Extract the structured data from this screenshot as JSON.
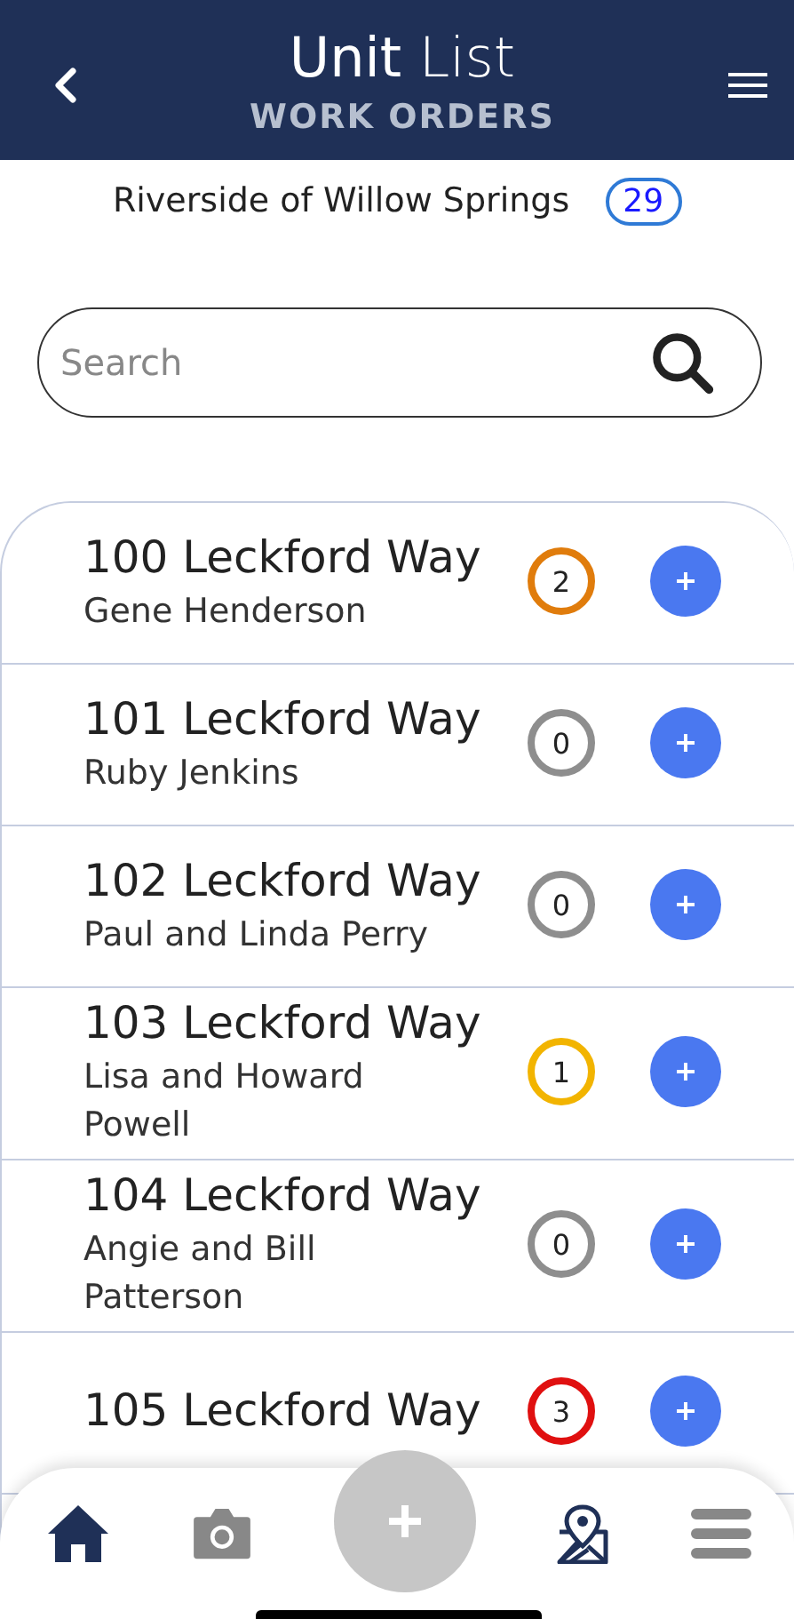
{
  "header": {
    "title": "**Unit** List",
    "subtitle": "WORK ORDERS"
  },
  "property": {
    "name": "Riverside of Willow Springs",
    "count": "29"
  },
  "search": {
    "placeholder": "Search"
  },
  "units": [
    {
      "address": "100 Leckford Way",
      "resident": "Gene Henderson",
      "count": "2",
      "color": "#e07c0c"
    },
    {
      "address": "101 Leckford Way",
      "resident": "Ruby Jenkins",
      "count": "0",
      "color": "#8e8e8e"
    },
    {
      "address": "102 Leckford Way",
      "resident": "Paul and Linda Perry",
      "count": "0",
      "color": "#8e8e8e"
    },
    {
      "address": "103 Leckford Way",
      "resident": "Lisa and Howard Powell",
      "count": "1",
      "color": "#f2b400"
    },
    {
      "address": "104 Leckford Way",
      "resident": "Angie and Bill Patterson",
      "count": "0",
      "color": "#8e8e8e"
    },
    {
      "address": "105 Leckford Way",
      "count": "3",
      "color": "#e01010"
    }
  ],
  "nav": [
    {
      "kind": "home"
    },
    {
      "kind": "camera"
    },
    {
      "kind": "add"
    },
    {
      "kind": "map"
    },
    {
      "kind": "menu"
    }
  ]
}
